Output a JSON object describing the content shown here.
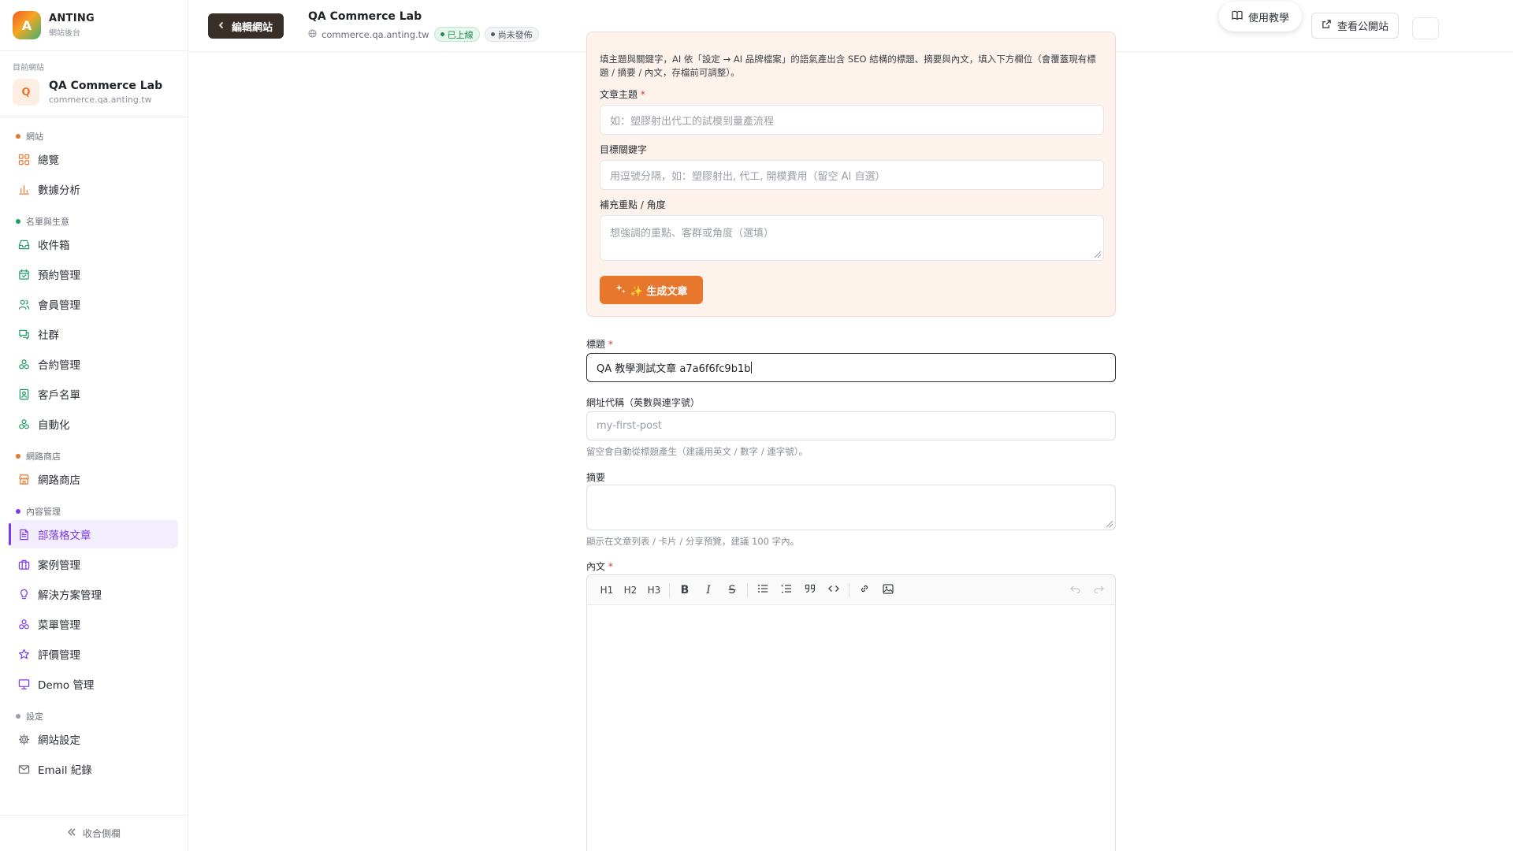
{
  "brand": {
    "logo_letter": "A",
    "name": "ANTING",
    "subtitle": "網站後台"
  },
  "current_site": {
    "caption": "目前網站",
    "avatar_letter": "Q",
    "name": "QA Commerce Lab",
    "domain": "commerce.qa.anting.tw"
  },
  "nav": {
    "groups": [
      {
        "title": "網站",
        "dot_color": "#e8772e",
        "items": [
          {
            "label": "總覽",
            "icon": "grid-icon",
            "color": "#e8772e"
          },
          {
            "label": "數據分析",
            "icon": "bar-chart-icon",
            "color": "#e8772e"
          }
        ]
      },
      {
        "title": "名單與生意",
        "dot_color": "#1f9d63",
        "items": [
          {
            "label": "收件箱",
            "icon": "inbox-icon",
            "color": "#1f9d63"
          },
          {
            "label": "預約管理",
            "icon": "calendar-icon",
            "color": "#1f9d63"
          },
          {
            "label": "會員管理",
            "icon": "users-icon",
            "color": "#1f9d63"
          },
          {
            "label": "社群",
            "icon": "chat-icon",
            "color": "#1f9d63"
          },
          {
            "label": "合約管理",
            "icon": "cluster-icon",
            "color": "#1f9d63"
          },
          {
            "label": "客戶名單",
            "icon": "contact-icon",
            "color": "#1f9d63"
          },
          {
            "label": "自動化",
            "icon": "cluster-icon",
            "color": "#1f9d63"
          }
        ]
      },
      {
        "title": "網路商店",
        "dot_color": "#e8772e",
        "items": [
          {
            "label": "網路商店",
            "icon": "store-icon",
            "color": "#e8772e"
          }
        ]
      },
      {
        "title": "內容管理",
        "dot_color": "#7c3aed",
        "items": [
          {
            "label": "部落格文章",
            "icon": "document-icon",
            "color": "#7c3aed",
            "active": true
          },
          {
            "label": "案例管理",
            "icon": "briefcase-icon",
            "color": "#7c3aed"
          },
          {
            "label": "解決方案管理",
            "icon": "lightbulb-icon",
            "color": "#7c3aed"
          },
          {
            "label": "菜單管理",
            "icon": "cluster-icon",
            "color": "#7c3aed"
          },
          {
            "label": "評價管理",
            "icon": "star-icon",
            "color": "#7c3aed"
          },
          {
            "label": "Demo 管理",
            "icon": "monitor-icon",
            "color": "#7c3aed"
          }
        ]
      },
      {
        "title": "設定",
        "dot_color": "#9aa0a8",
        "items": [
          {
            "label": "網站設定",
            "icon": "gear-icon",
            "color": "#6b7078"
          },
          {
            "label": "Email 紀錄",
            "icon": "mail-icon",
            "color": "#6b7078"
          }
        ]
      }
    ],
    "collapse_label": "收合側欄"
  },
  "header": {
    "back_label": "編輯網站",
    "site_title": "QA Commerce Lab",
    "site_domain": "commerce.qa.anting.tw",
    "badge_online": "已上線",
    "badge_unpublished": "尚未發佈",
    "view_public_label": "查看公開站",
    "help_label": "使用教學"
  },
  "ai_generator": {
    "description": "填主題與關鍵字，AI 依「設定 → AI 品牌檔案」的語氣產出含 SEO 結構的標題、摘要與內文，填入下方欄位（會覆蓋現有標題 / 摘要 / 內文，存檔前可調整）。",
    "topic_label": "文章主題",
    "topic_placeholder": "如：塑膠射出代工的試模到量產流程",
    "keywords_label": "目標關鍵字",
    "keywords_placeholder": "用逗號分隔，如：塑膠射出, 代工, 開模費用（留空 AI 自選）",
    "angle_label": "補充重點 / 角度",
    "angle_placeholder": "想強調的重點、客群或角度（選填）",
    "generate_label": "✨ 生成文章"
  },
  "form": {
    "title_label": "標題",
    "title_value": "QA 教學測試文章 a7a6f6fc9b1b",
    "slug_label": "網址代稱（英數與連字號）",
    "slug_placeholder": "my-first-post",
    "slug_hint": "留空會自動從標題產生（建議用英文 / 數字 / 連字號）。",
    "excerpt_label": "摘要",
    "excerpt_hint": "顯示在文章列表 / 卡片 / 分享預覽，建議 100 字內。",
    "body_label": "內文",
    "required_mark": "*"
  },
  "editor_toolbar": {
    "h1": "H1",
    "h2": "H2",
    "h3": "H3",
    "bold": "B",
    "italic": "I",
    "strike": "S",
    "bullet_list_icon": "bullet-list-icon",
    "ordered_list_icon": "ordered-list-icon",
    "quote_icon": "quote-icon",
    "code_icon": "code-icon",
    "link_icon": "link-icon",
    "image_icon": "image-icon",
    "undo_icon": "undo-icon",
    "redo_icon": "redo-icon"
  }
}
